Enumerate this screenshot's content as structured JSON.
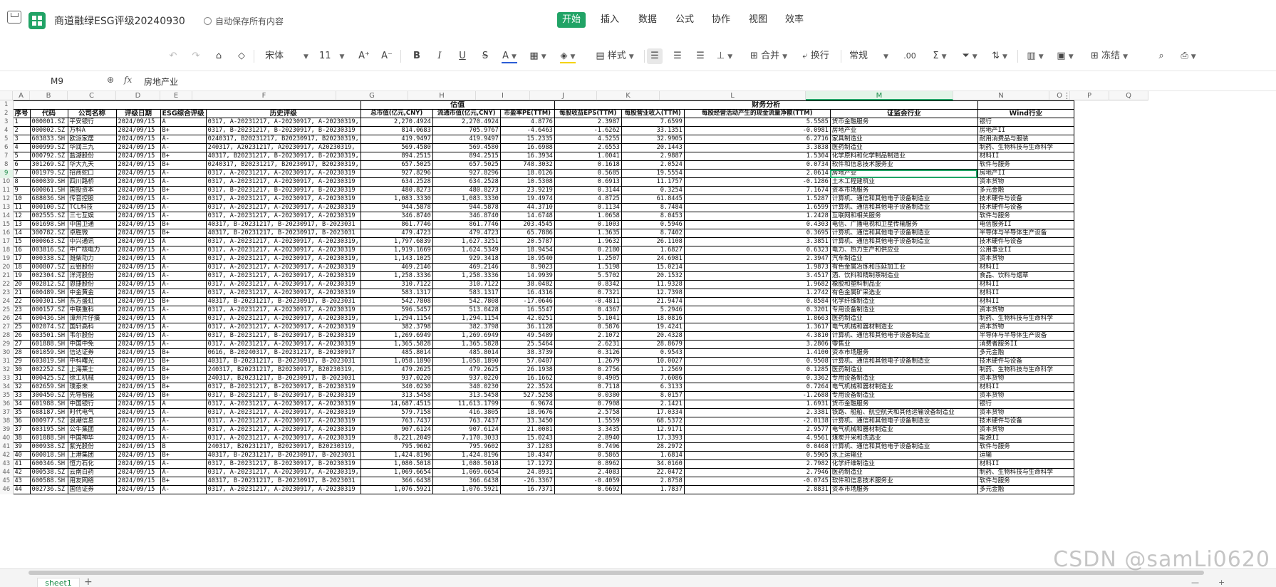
{
  "app": {
    "doc_title": "商道融绿ESG评级20240930",
    "save_status": "自动保存所有内容",
    "menu": [
      "开始",
      "插入",
      "数据",
      "公式",
      "协作",
      "视图",
      "效率"
    ],
    "active_menu": "开始"
  },
  "toolbar": {
    "font_name": "宋体",
    "font_size": "11",
    "increase_font": "A⁺",
    "decrease_font": "A⁻",
    "bold": "B",
    "italic": "I",
    "underline": "U",
    "strike": "S",
    "font_color": "A",
    "style_label": "样式",
    "merge_label": "合并",
    "wrap_label": "换行",
    "number_format": "常规",
    "decimal_label": ".00",
    "sum_label": "Σ",
    "freeze_label": "冻结",
    "font_color_hex": "#2b5dd6",
    "fill_color_hex": "#f5d300"
  },
  "formula_bar": {
    "cell_ref": "M9",
    "fx": "fx",
    "content": "房地产业"
  },
  "columns": [
    "A",
    "B",
    "C",
    "D",
    "E",
    "F",
    "G",
    "H",
    "I",
    "J",
    "K",
    "L",
    "M",
    "N",
    "O",
    "P",
    "Q"
  ],
  "active_column": "M",
  "active_row": "9",
  "header_group": {
    "valuation": "估值",
    "financial": "财务分析"
  },
  "headers": [
    "序号",
    "代码",
    "公司名称",
    "评级日期",
    "ESG综合评级",
    "历史评级",
    "总市值(亿元,CNY)",
    "流通市值(亿元,CNY)",
    "市盈率PE(TTM)",
    "每股收益EPS(TTM)",
    "每股营业收入(TTM)",
    "每股经营活动产生的现金流量净额(TTM)",
    "证监会行业",
    "Wind行业"
  ],
  "rows": [
    [
      "1",
      "000001.SZ",
      "平安银行",
      "2024/09/15",
      "A",
      "0317, A-20231217, A-20230917, A-20230319,",
      "2,270.4924",
      "2,270.4924",
      "4.8776",
      "2.3987",
      "7.6599",
      "5.5585",
      "货币金融服务",
      "银行"
    ],
    [
      "2",
      "000002.SZ",
      "万科A",
      "2024/09/15",
      "B+",
      "0317, B-20231217, B-20230917, B-20230319",
      "814.0683",
      "705.9767",
      "-4.6463",
      "-1.6262",
      "33.1351",
      "-0.0981",
      "房地产业",
      "房地产II"
    ],
    [
      "3",
      "603833.SH",
      "欧派家居",
      "2024/09/15",
      "A-",
      "0240317, B20231217, B20230917, B20230319,",
      "419.9497",
      "419.9497",
      "15.2335",
      "4.5255",
      "32.9905",
      "6.2716",
      "家具制造业",
      "耐用消费品与服装"
    ],
    [
      "4",
      "000999.SZ",
      "华润三九",
      "2024/09/15",
      "A-",
      "240317, A20231217, A20230917, A20230319,",
      "569.4580",
      "569.4580",
      "16.6988",
      "2.6553",
      "20.1443",
      "3.3838",
      "医药制造业",
      "制药、生物科技与生命科学"
    ],
    [
      "5",
      "000792.SZ",
      "盐湖股份",
      "2024/09/15",
      "B+",
      "40317, B20231217, B-20230917, B-20230319,",
      "894.2515",
      "894.2515",
      "16.3934",
      "1.0041",
      "2.9887",
      "1.5304",
      "化学原料和化学制品制造业",
      "材料II"
    ],
    [
      "6",
      "301269.SZ",
      "华大九天",
      "2024/09/15",
      "B+",
      "0240317, B20231217, B20230917, B20230319,",
      "657.5025",
      "657.5025",
      "748.3032",
      "0.1618",
      "2.0524",
      "0.0734",
      "软件和信息技术服务业",
      "软件与服务"
    ],
    [
      "7",
      "001979.SZ",
      "招商蛇口",
      "2024/09/15",
      "A-",
      "0317, A-20231217, A-20230917, A-20230319",
      "927.8296",
      "927.8296",
      "18.0126",
      "0.5685",
      "19.5554",
      "2.0614",
      "房地产业",
      "房地产II"
    ],
    [
      "8",
      "600039.SH",
      "四川路桥",
      "2024/09/15",
      "A-",
      "0317, A-20231217, A-20230917, A-20230319",
      "634.2528",
      "634.2528",
      "10.5308",
      "0.6913",
      "11.1757",
      "-0.1286",
      "土木工程建筑业",
      "资本货物"
    ],
    [
      "9",
      "600061.SH",
      "国投资本",
      "2024/09/15",
      "B+",
      "0317, B-20231217, B-20230917, B-20230319",
      "480.8273",
      "480.8273",
      "23.9219",
      "0.3144",
      "0.3254",
      "7.1674",
      "资本市场服务",
      "多元金融"
    ],
    [
      "10",
      "688036.SH",
      "传音控股",
      "2024/09/15",
      "A-",
      "0317, A-20231217, A-20230917, A-20230319",
      "1,083.3330",
      "1,083.3330",
      "19.4974",
      "4.8725",
      "61.8445",
      "1.5287",
      "计算机、通信和其他电子设备制造业",
      "技术硬件与设备"
    ],
    [
      "11",
      "000100.SZ",
      "TCL科技",
      "2024/09/15",
      "A-",
      "0317, A-20231217, A-20230917, A-20230319",
      "944.5878",
      "944.5878",
      "44.3710",
      "0.1134",
      "8.7484",
      "1.6599",
      "计算机、通信和其他电子设备制造业",
      "技术硬件与设备"
    ],
    [
      "12",
      "002555.SZ",
      "三七互娱",
      "2024/09/15",
      "A-",
      "0317, A-20231217, A-20230917, A-20230319",
      "346.8740",
      "346.8740",
      "14.6748",
      "1.0658",
      "8.0453",
      "1.2428",
      "互联网和相关服务",
      "软件与服务"
    ],
    [
      "13",
      "601698.SH",
      "中国卫通",
      "2024/09/15",
      "B+",
      "40317, B-20231217, B-20230917, B-2023031",
      "861.7746",
      "861.7746",
      "203.4545",
      "0.1003",
      "0.5946",
      "0.4303",
      "电信、广播电视和卫星传输服务",
      "电信服务II"
    ],
    [
      "14",
      "300782.SZ",
      "卓胜微",
      "2024/09/15",
      "B+",
      "40317, B-20231217, B-20230917, B-2023031",
      "479.4723",
      "479.4723",
      "65.7886",
      "1.3635",
      "8.7402",
      "0.3695",
      "计算机、通信和其他电子设备制造业",
      "半导体与半导体生产设备"
    ],
    [
      "15",
      "000063.SZ",
      "中兴通讯",
      "2024/09/15",
      "A",
      "0317, A-20231217, A-20230917, A-20230319,",
      "1,797.6839",
      "1,627.3251",
      "20.5787",
      "1.9632",
      "26.1108",
      "3.3851",
      "计算机、通信和其他电子设备制造业",
      "技术硬件与设备"
    ],
    [
      "16",
      "003816.SZ",
      "中广核电力",
      "2024/09/15",
      "A-",
      "0317, A-20231217, A-20230917, A-20230319",
      "1,919.1669",
      "1,624.5349",
      "18.9454",
      "0.2180",
      "1.6827",
      "0.6323",
      "电力、热力生产和供应业",
      "公用事业II"
    ],
    [
      "17",
      "000338.SZ",
      "潍柴动力",
      "2024/09/15",
      "A",
      "0317, A-20231217, A-20230917, A-20230319,",
      "1,143.1025",
      "929.3418",
      "10.9540",
      "1.2507",
      "24.6981",
      "2.3947",
      "汽车制造业",
      "资本货物"
    ],
    [
      "18",
      "000807.SZ",
      "云铝股份",
      "2024/09/15",
      "A-",
      "0317, A-20231217, A-20230917, A-20230319",
      "469.2146",
      "469.2146",
      "8.9023",
      "1.5198",
      "15.0214",
      "1.9873",
      "有色金属冶炼和压延加工业",
      "材料II"
    ],
    [
      "19",
      "002304.SZ",
      "洋河股份",
      "2024/09/15",
      "A-",
      "0317, A-20231217, A-20230917, A-20230319",
      "1,258.3336",
      "1,258.3336",
      "14.9939",
      "5.5702",
      "20.1532",
      "3.4517",
      "酒、饮料和精制茶制造业",
      "食品、饮料与烟草"
    ],
    [
      "20",
      "002812.SZ",
      "恩捷股份",
      "2024/09/15",
      "A-",
      "0317, A-20231217, A-20230917, A-20230319",
      "310.7122",
      "310.7122",
      "38.0482",
      "0.8342",
      "11.9328",
      "1.9682",
      "橡胶和塑料制品业",
      "材料II"
    ],
    [
      "21",
      "600489.SH",
      "中金黄金",
      "2024/09/15",
      "A-",
      "0317, A-20231217, A-20230917, A-20230319",
      "583.1317",
      "583.1317",
      "16.4316",
      "0.7321",
      "12.7398",
      "1.2742",
      "有色金属矿采选业",
      "材料II"
    ],
    [
      "22",
      "600301.SH",
      "东方盛虹",
      "2024/09/15",
      "B+",
      "40317, B-20231217, B-20230917, B-2023031",
      "542.7808",
      "542.7808",
      "-17.0646",
      "-0.4811",
      "21.9474",
      "0.8584",
      "化学纤维制造业",
      "材料II"
    ],
    [
      "23",
      "000157.SZ",
      "中联重科",
      "2024/09/15",
      "A-",
      "0317, A-20231217, A-20230917, A-20230319",
      "596.5457",
      "513.0428",
      "16.5547",
      "0.4367",
      "5.2946",
      "0.3201",
      "专用设备制造业",
      "资本货物"
    ],
    [
      "24",
      "600436.SH",
      "漳州片仔癀",
      "2024/09/15",
      "A",
      "0317, A-20231217, A-20230917, A-20230319,",
      "1,294.1154",
      "1,294.1154",
      "42.0251",
      "5.1041",
      "18.0816",
      "1.8663",
      "医药制造业",
      "制药、生物科技与生命科学"
    ],
    [
      "25",
      "002074.SZ",
      "国轩高科",
      "2024/09/15",
      "A-",
      "0317, A-20231217, A-20230917, A-20230319",
      "382.3798",
      "382.3798",
      "36.1128",
      "0.5876",
      "19.4241",
      "1.3617",
      "电气机械和器材制造业",
      "资本货物"
    ],
    [
      "26",
      "603501.SH",
      "韦尔股份",
      "2024/09/15",
      "A-",
      "0317, B-20231217, B-20230917, B-20230319",
      "1,269.6949",
      "1,269.6949",
      "49.5489",
      "2.1072",
      "20.4328",
      "4.3810",
      "计算机、通信和其他电子设备制造业",
      "半导体与半导体生产设备"
    ],
    [
      "27",
      "601888.SH",
      "中国中免",
      "2024/09/15",
      "A-",
      "0317, A-20231217, A-20230917, A-20230319",
      "1,365.5828",
      "1,365.5828",
      "25.5464",
      "2.6231",
      "28.8679",
      "3.2806",
      "零售业",
      "消费者服务II"
    ],
    [
      "28",
      "601059.SH",
      "信达证券",
      "2024/09/15",
      "B+",
      "0616, B-20240317, B-20231217, B-20230917",
      "485.8014",
      "485.8014",
      "38.3739",
      "0.3126",
      "0.9543",
      "1.4100",
      "资本市场服务",
      "多元金融"
    ],
    [
      "29",
      "603019.SH",
      "中科曙光",
      "2024/09/15",
      "B+",
      "40317, B-20231217, B-20230917, B-2023031",
      "1,058.1890",
      "1,058.1890",
      "57.0407",
      "1.2679",
      "10.0027",
      "0.9508",
      "计算机、通信和其他电子设备制造业",
      "技术硬件与设备"
    ],
    [
      "30",
      "002252.SZ",
      "上海莱士",
      "2024/09/15",
      "B+",
      "240317, B20231217, B20230917, B20230319,",
      "479.2625",
      "479.2625",
      "26.1938",
      "0.2756",
      "1.2569",
      "0.1285",
      "医药制造业",
      "制药、生物科技与生命科学"
    ],
    [
      "31",
      "000425.SZ",
      "徐工机械",
      "2024/09/15",
      "B+",
      "240317, B20231217, B-20230917, B-2023031",
      "937.0220",
      "937.0220",
      "16.1662",
      "0.4905",
      "7.6086",
      "0.3362",
      "专用设备制造业",
      "资本货物"
    ],
    [
      "32",
      "602659.SH",
      "璞泰来",
      "2024/09/15",
      "B+",
      "0317, B-20231217, B-20230917, B-20230319",
      "340.0230",
      "340.0230",
      "22.3524",
      "0.7118",
      "6.3133",
      "0.7264",
      "电气机械和器材制造业",
      "材料II"
    ],
    [
      "33",
      "300450.SZ",
      "先导智能",
      "2024/09/15",
      "B+",
      "0317, B-20231217, B-20230917, B-20230319",
      "313.5458",
      "313.5458",
      "527.5258",
      "0.0380",
      "8.0157",
      "-1.2688",
      "专用设备制造业",
      "资本货物"
    ],
    [
      "34",
      "601988.SH",
      "中国银行",
      "2024/09/15",
      "A",
      "0317, A-20231217, A-20230917, A-20230319",
      "14,687.4515",
      "11,613.1799",
      "6.9674",
      "0.7908",
      "2.1421",
      "1.6931",
      "货币金融服务",
      "银行"
    ],
    [
      "35",
      "688187.SH",
      "时代电气",
      "2024/09/15",
      "A-",
      "0317, A-20231217, A-20230917, A-20230319",
      "579.7158",
      "416.3805",
      "18.9676",
      "2.5758",
      "17.0334",
      "2.3381",
      "铁路、船舶、航空航天和其他运输设备制造业",
      "资本货物"
    ],
    [
      "36",
      "000977.SZ",
      "浪潮信息",
      "2024/09/15",
      "A-",
      "0317, A-20231217, A-20230917, A-20230319",
      "763.7437",
      "763.7437",
      "33.3450",
      "1.5559",
      "68.5372",
      "-2.0138",
      "计算机、通信和其他电子设备制造业",
      "技术硬件与设备"
    ],
    [
      "37",
      "603195.SH",
      "公牛集团",
      "2024/09/15",
      "A-",
      "0317, A-20231217, A-20230917, A-20230319",
      "907.6124",
      "907.6124",
      "21.0081",
      "3.3435",
      "12.9171",
      "2.9577",
      "电气机械和器材制造业",
      "资本货物"
    ],
    [
      "38",
      "601088.SH",
      "中国神华",
      "2024/09/15",
      "A-",
      "0317, A-20231217, A-20230917, A-20230319",
      "8,221.2049",
      "7,170.3033",
      "15.0243",
      "2.8940",
      "17.3393",
      "4.9561",
      "煤炭开采和洗选业",
      "能源II"
    ],
    [
      "39",
      "000938.SZ",
      "紫光股份",
      "2024/09/15",
      "B",
      "240317, B20231217, B20230917, B20230319,",
      "795.9602",
      "795.9602",
      "37.1283",
      "0.7496",
      "28.2972",
      "0.0468",
      "计算机、通信和其他电子设备制造业",
      "软件与服务"
    ],
    [
      "40",
      "600018.SH",
      "上港集团",
      "2024/09/15",
      "B+",
      "40317, B-20231217, B-20230917, B-2023031",
      "1,424.8196",
      "1,424.8196",
      "10.4347",
      "0.5865",
      "1.6814",
      "0.5905",
      "水上运输业",
      "运输"
    ],
    [
      "41",
      "600346.SH",
      "恒力石化",
      "2024/09/15",
      "A-",
      "0317, B-20231217, B-20230917, B-20230319",
      "1,080.5018",
      "1,080.5018",
      "17.1272",
      "0.8962",
      "34.0160",
      "2.7982",
      "化学纤维制造业",
      "材料II"
    ],
    [
      "42",
      "000538.SZ",
      "云南白药",
      "2024/09/15",
      "A-",
      "0317, A-20231217, A-20230917, A-20230319,",
      "1,069.6654",
      "1,069.6654",
      "24.8931",
      "2.4083",
      "22.0472",
      "2.7946",
      "医药制造业",
      "制药、生物科技与生命科学"
    ],
    [
      "43",
      "600588.SH",
      "用友网络",
      "2024/09/15",
      "B+",
      "40317, B-20231217, B-20230917, B-2023031",
      "366.6438",
      "366.6438",
      "-26.3367",
      "-0.4059",
      "2.8758",
      "-0.0745",
      "软件和信息技术服务业",
      "软件与服务"
    ],
    [
      "44",
      "002736.SZ",
      "国信证券",
      "2024/09/15",
      "A-",
      "0317, A-20231217, A-20230917, A-20230319",
      "1,076.5921",
      "1,076.5921",
      "16.7371",
      "0.6692",
      "1.7837",
      "2.8831",
      "资本市场服务",
      "多元金融"
    ]
  ],
  "sheet_tab": "sheet1",
  "watermark": "CSDN @samLi0620"
}
